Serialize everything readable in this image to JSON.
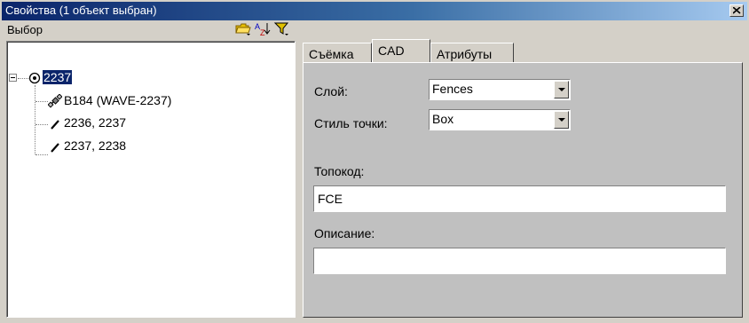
{
  "window": {
    "title": "Свойства (1 объект выбран)"
  },
  "left": {
    "selection_label": "Выбор",
    "toolbar_icons": [
      "folder-icon",
      "sort-az-icon",
      "filter-icon"
    ],
    "tree": {
      "root": "2237",
      "children": [
        {
          "label": "B184 (WAVE-2237)",
          "icon": "satellite-icon"
        },
        {
          "label": "2236, 2237",
          "icon": "line-segment-icon"
        },
        {
          "label": "2237, 2238",
          "icon": "line-segment-icon"
        }
      ]
    }
  },
  "tabs": [
    {
      "label": "Съёмка"
    },
    {
      "label": "CAD"
    },
    {
      "label": "Атрибуты"
    }
  ],
  "active_tab": "CAD",
  "cad": {
    "layer_label": "Слой:",
    "layer_value": "Fences",
    "point_style_label": "Стиль точки:",
    "point_style_value": "Box",
    "topocode_label": "Топокод:",
    "topocode_value": "FCE",
    "description_label": "Описание:",
    "description_value": ""
  },
  "colors": {
    "title_bar": "#0a246a",
    "panel": "#d4d0c8",
    "tab_body": "#c0c0c0",
    "selection": "#0a246a"
  }
}
